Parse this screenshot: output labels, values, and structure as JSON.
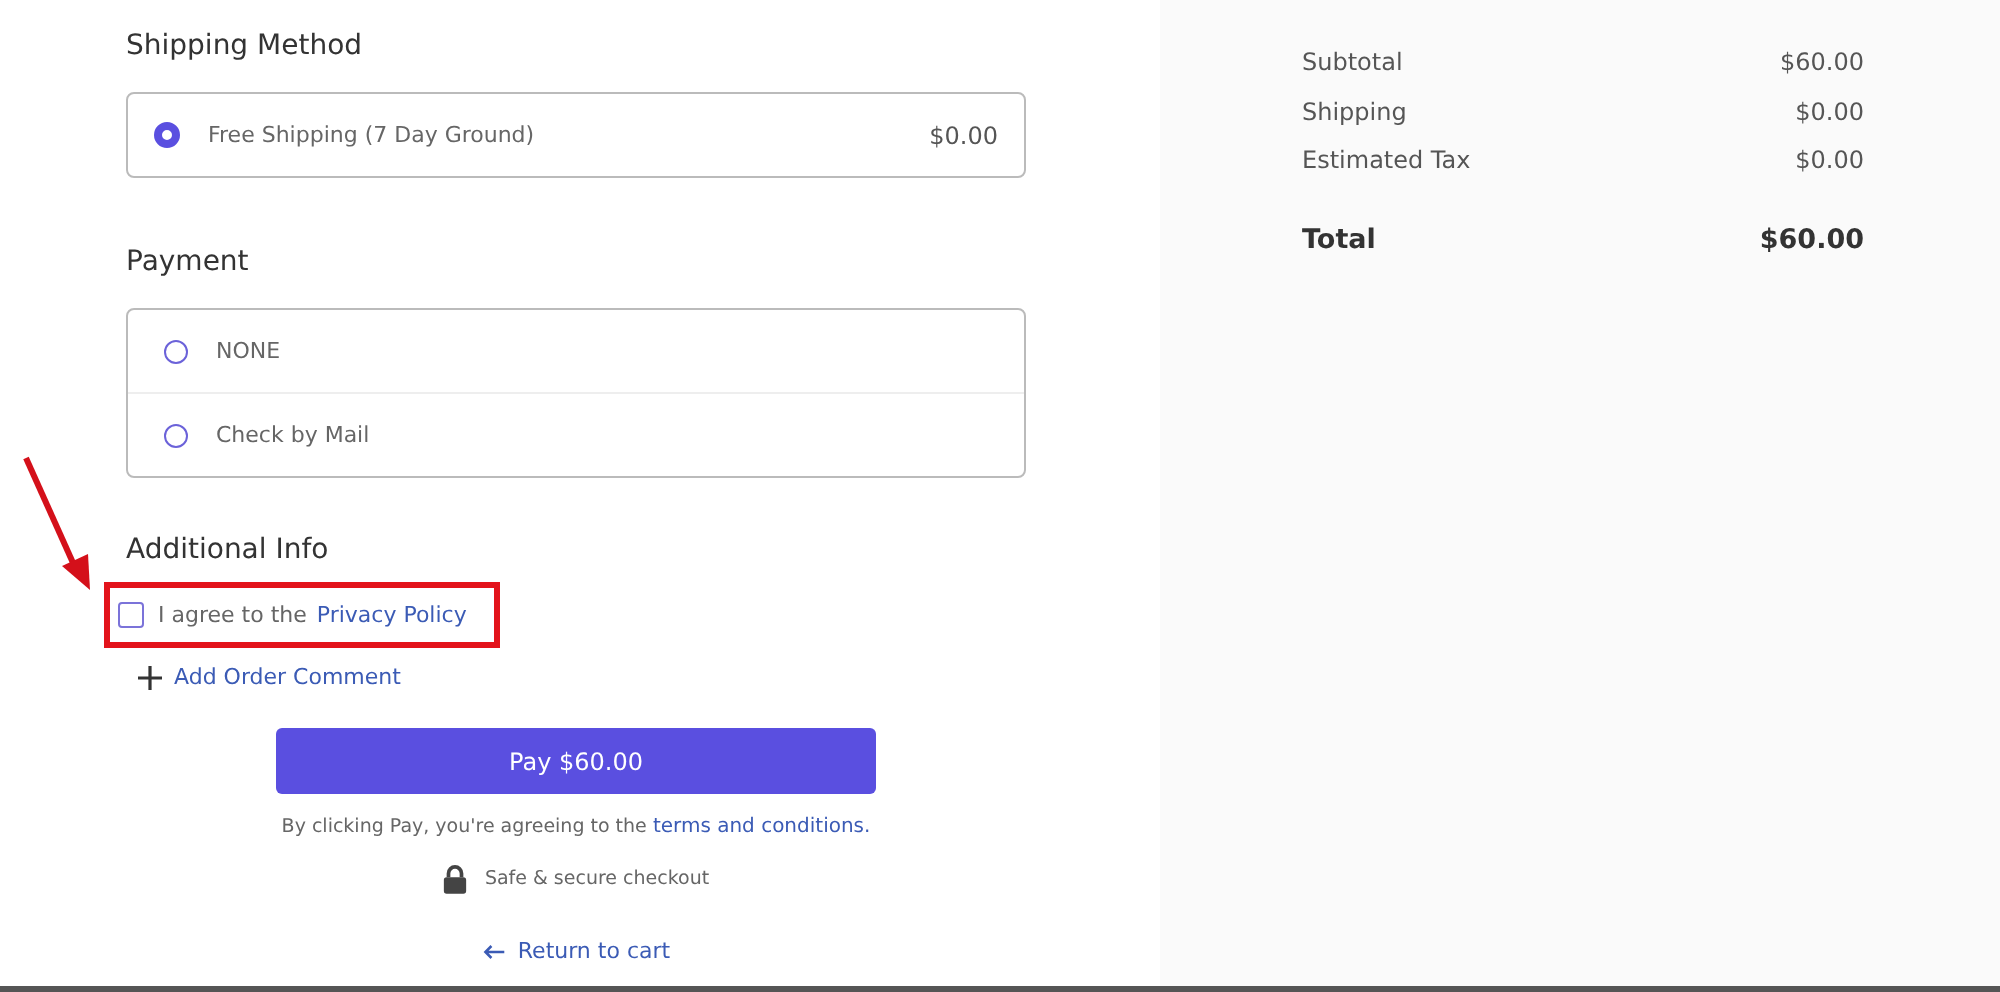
{
  "shipping_method": {
    "title": "Shipping Method",
    "options": [
      {
        "label": "Free Shipping (7 Day Ground)",
        "price": "$0.00",
        "selected": true
      }
    ]
  },
  "payment": {
    "title": "Payment",
    "options": [
      {
        "label": "NONE",
        "selected": false
      },
      {
        "label": "Check by Mail",
        "selected": false
      }
    ]
  },
  "additional_info": {
    "title": "Additional Info",
    "agree": {
      "text": "I agree to the",
      "link": "Privacy Policy",
      "checked": false
    },
    "add_comment": "Add Order Comment"
  },
  "pay_button": "Pay $60.00",
  "terms": {
    "text": "By clicking Pay, you're agreeing to the",
    "link": "terms and conditions."
  },
  "secure_note": "Safe & secure checkout",
  "return_link": "Return to cart",
  "summary": {
    "lines": [
      {
        "label": "Subtotal",
        "value": "$60.00"
      },
      {
        "label": "Shipping",
        "value": "$0.00"
      },
      {
        "label": "Estimated Tax",
        "value": "$0.00"
      }
    ],
    "total": {
      "label": "Total",
      "value": "$60.00"
    }
  }
}
